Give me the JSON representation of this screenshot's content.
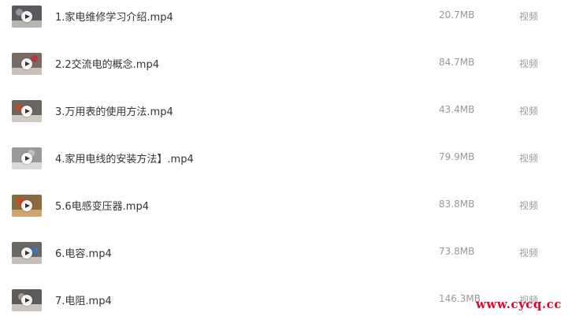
{
  "files": [
    {
      "name": "1.家电维修学习介绍.mp4",
      "size": "20.7MB",
      "type": "视频",
      "thumb_colors": [
        "#5a5a60",
        "#9e9aa0",
        "#c8c4c0"
      ]
    },
    {
      "name": "2.2交流电的概念.mp4",
      "size": "84.7MB",
      "type": "视频",
      "thumb_colors": [
        "#7a6a64",
        "#b03a38",
        "#d8d0c8"
      ]
    },
    {
      "name": "3.万用表的使用方法.mp4",
      "size": "43.4MB",
      "type": "视频",
      "thumb_colors": [
        "#6a6660",
        "#c24a30",
        "#e0dcd4"
      ]
    },
    {
      "name": "4.家用电线的安装方法】.mp4",
      "size": "79.9MB",
      "type": "视频",
      "thumb_colors": [
        "#9a9a9a",
        "#c8c8c8",
        "#e4e4e4"
      ]
    },
    {
      "name": "5.6电感变压器.mp4",
      "size": "83.8MB",
      "type": "视频",
      "thumb_colors": [
        "#8a6a40",
        "#c44a22",
        "#d8b078"
      ]
    },
    {
      "name": "6.电容.mp4",
      "size": "73.8MB",
      "type": "视频",
      "thumb_colors": [
        "#6a6864",
        "#3a72c0",
        "#d4d0cc"
      ]
    },
    {
      "name": "7.电阻.mp4",
      "size": "146.3MB",
      "type": "视频",
      "thumb_colors": [
        "#5e5c5a",
        "#a8a4a0",
        "#dcd8d4"
      ]
    }
  ],
  "watermark": "www.cycq.cc"
}
